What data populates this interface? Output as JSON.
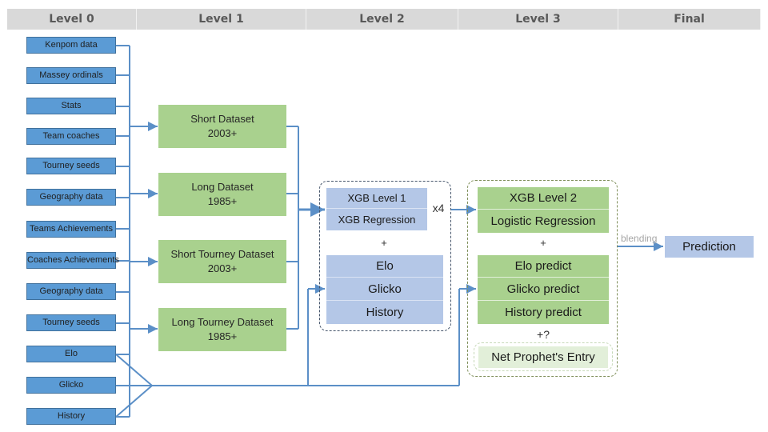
{
  "headers": [
    "Level 0",
    "Level 1",
    "Level 2",
    "Level 3",
    "Final"
  ],
  "level0": {
    "items": [
      "Kenpom data",
      "Massey ordinals",
      "Stats",
      "Team coaches",
      "Tourney seeds",
      "Geography data",
      "Teams Achievements",
      "Coaches Achievements",
      "Geography data",
      "Tourney seeds",
      "Elo",
      "Glicko",
      "History"
    ]
  },
  "level1": {
    "datasets": [
      {
        "name": "Short Dataset",
        "years": "2003+"
      },
      {
        "name": "Long Dataset",
        "years": "1985+"
      },
      {
        "name": "Short Tourney Dataset",
        "years": "2003+"
      },
      {
        "name": "Long Tourney Dataset",
        "years": "1985+"
      }
    ]
  },
  "level2": {
    "xgb_title": "XGB Level 1",
    "xgb_sub": "XGB Regression",
    "multiplier": "x4",
    "plus": "+",
    "ratings": [
      "Elo",
      "Glicko",
      "History"
    ]
  },
  "level3": {
    "xgb_title": "XGB Level 2",
    "xgb_sub": "Logistic Regression",
    "plus": "+",
    "predicts": [
      "Elo predict",
      "Glicko predict",
      "History predict"
    ],
    "optional_plus": "+?",
    "optional_entry": "Net Prophet's Entry"
  },
  "final": {
    "edge_label": "blending",
    "output": "Prediction"
  },
  "colors": {
    "level0_fill": "#5b9bd5",
    "dataset_fill": "#a9d18e",
    "model_blue": "#b4c7e7",
    "connector": "#5b8fc7",
    "header_fill": "#d9d9d9"
  }
}
